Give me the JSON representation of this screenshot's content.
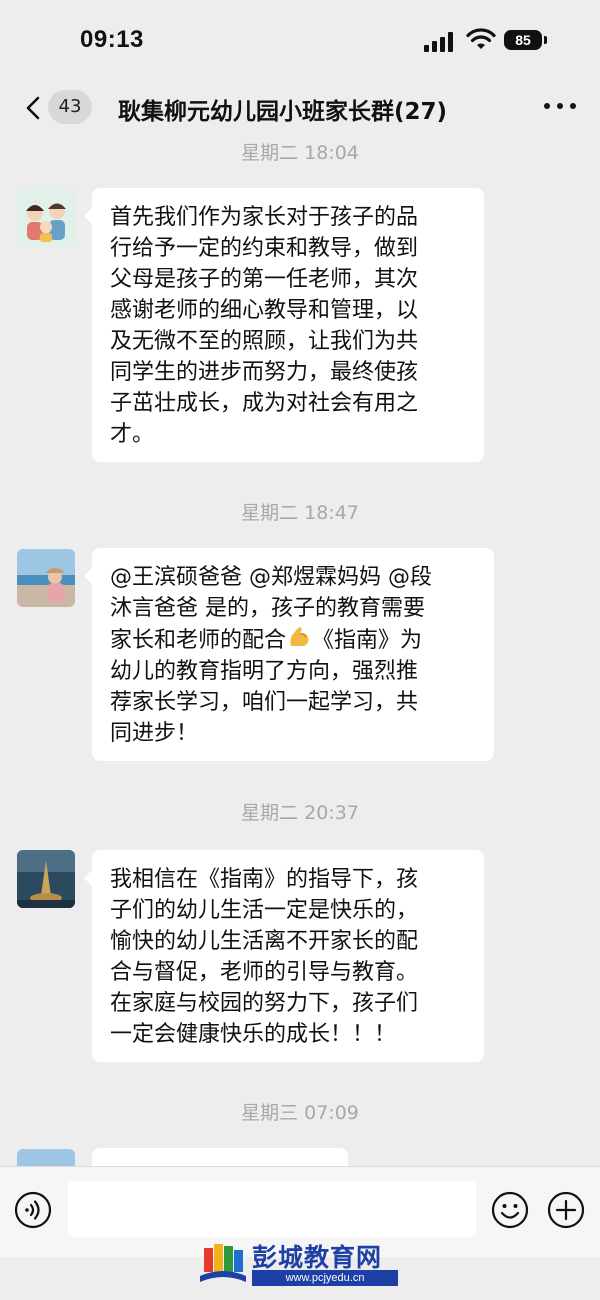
{
  "status_bar": {
    "time": "09:13",
    "battery": "85"
  },
  "nav": {
    "unread_count": "43",
    "title": "耿集柳元幼儿园小班家长群(27)"
  },
  "messages": [
    {
      "timestamp": "星期二 18:04",
      "lines": [
        "首先我们作为家长对于孩子的品",
        "行给予一定的约束和教导，做到",
        "父母是孩子的第一任老师，其次",
        "感谢老师的细心教导和管理，以",
        "及无微不至的照顾，让我们为共",
        "同学生的进步而努力，最终使孩",
        "子茁壮成长，成为对社会有用之",
        "才。"
      ]
    },
    {
      "timestamp": "星期二 18:47",
      "lines": [
        "@王滨硕爸爸 @郑煜霖妈妈 @段",
        "沐言爸爸 是的，孩子的教育需要",
        "家长和老师的配合",
        "《指南》为",
        "幼儿的教育指明了方向，强烈推",
        "荐家长学习，咱们一起学习，共",
        "同进步！"
      ]
    },
    {
      "timestamp": "星期二 20:37",
      "lines": [
        "我相信在《指南》的指导下，孩",
        "子们的幼儿生活一定是快乐的，",
        "愉快的幼儿生活离不开家长的配",
        "合与督促，老师的引导与教育。",
        "在家庭与校园的努力下，孩子们",
        "一定会健康快乐的成长！！！"
      ]
    },
    {
      "timestamp": "星期三 07:09",
      "lines": []
    }
  ],
  "input_bar": {
    "placeholder": ""
  },
  "watermark": {
    "title": "彭城教育网",
    "url": "www.pcjyedu.cn"
  },
  "colors": {
    "background": "#ededed",
    "bubble": "#ffffff",
    "watermark_blue": "#1e3fa6"
  },
  "icons": [
    "back-arrow-icon",
    "more-icon",
    "voice-icon",
    "emoji-icon",
    "plus-icon",
    "signal-icon",
    "wifi-icon",
    "battery-icon",
    "flexed-biceps-emoji"
  ]
}
